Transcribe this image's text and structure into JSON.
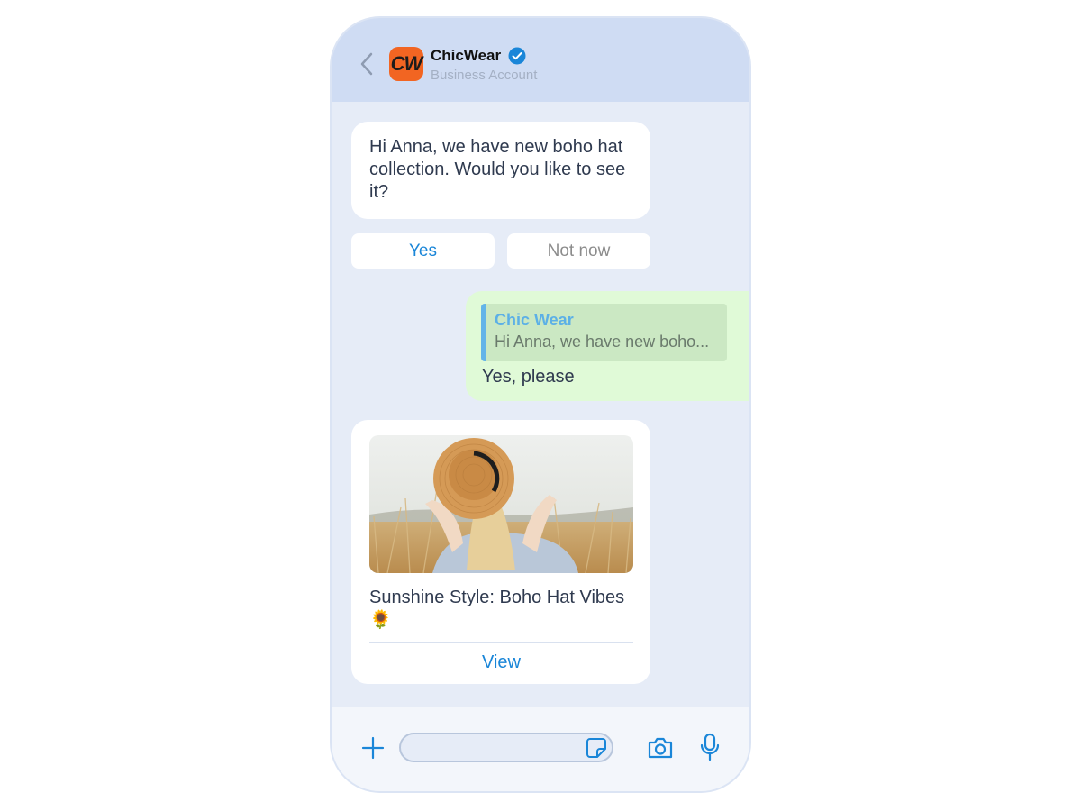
{
  "header": {
    "logo_text": "CW",
    "brand_name": "ChicWear",
    "account_type": "Business Account",
    "icons": {
      "back": "chevron-left-icon",
      "verified": "verified-badge-icon"
    },
    "colors": {
      "header_bg": "#cfdcf3",
      "logo_bg": "#f26522",
      "verified": "#1a86d8"
    }
  },
  "messages": {
    "incoming": {
      "text": "Hi Anna, we have new boho hat collection. Would you like to see it?"
    },
    "quick_replies": [
      {
        "label": "Yes"
      },
      {
        "label": "Not now"
      }
    ],
    "outgoing": {
      "quoted_author": "Chic Wear",
      "quoted_text": "Hi Anna, we have new boho...",
      "text": "Yes, please"
    },
    "card": {
      "title": "Sunshine Style: Boho Hat Vibes 🌻",
      "action_label": "View"
    }
  },
  "composer": {
    "placeholder": "",
    "icons": [
      "plus-icon",
      "sticker-icon",
      "camera-icon",
      "microphone-icon"
    ],
    "accent_color": "#1a86d8"
  }
}
